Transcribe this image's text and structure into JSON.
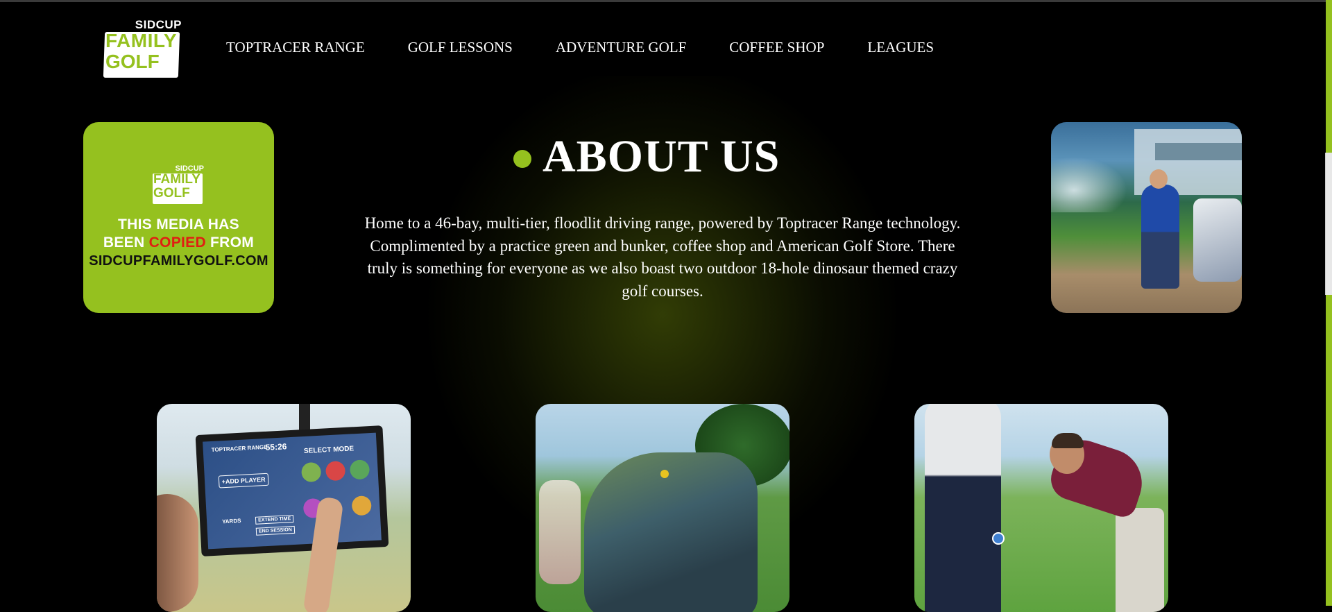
{
  "brand": {
    "logo_top": "SIDCUP",
    "logo_line1": "FAMILY",
    "logo_line2": "GOLF",
    "accent_color": "#95c11f"
  },
  "nav": {
    "items": [
      {
        "label": "TOPTRACER RANGE"
      },
      {
        "label": "GOLF LESSONS"
      },
      {
        "label": "ADVENTURE GOLF"
      },
      {
        "label": "COFFEE SHOP"
      },
      {
        "label": "LEAGUES"
      }
    ]
  },
  "copied_notice": {
    "line1": "THIS MEDIA HAS",
    "line2_before": "BEEN ",
    "line2_highlight": "COPIED",
    "line2_after": " FROM",
    "line3": "SIDCUPFAMILYGOLF.COM"
  },
  "about": {
    "title": "ABOUT US",
    "body": "Home to a 46-bay, multi-tier, floodlit driving range, powered by Toptracer Range technology. Complimented by a practice green and bunker, coffee shop and American Golf Store. There truly is something for everyone as we also boast two outdoor 18-hole dinosaur themed crazy golf courses."
  },
  "tablet_screen": {
    "brand": "TOPTRACER RANGE",
    "time": "55:26",
    "mode": "SELECT MODE",
    "add_player": "+ADD PLAYER",
    "yards": "YARDS",
    "extend": "EXTEND TIME",
    "end": "END SESSION"
  }
}
